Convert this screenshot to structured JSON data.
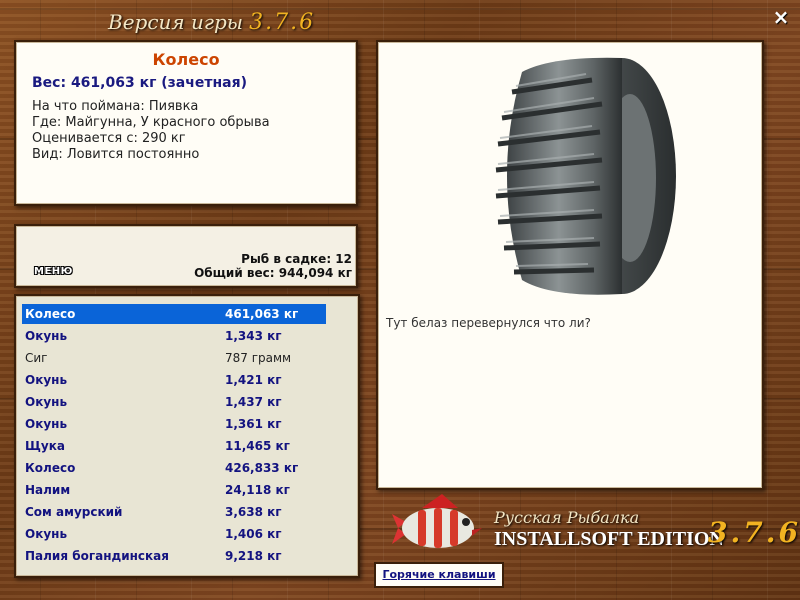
{
  "header": {
    "title": "Версия игры",
    "version": "3.7.6"
  },
  "close_icon": "×",
  "info": {
    "name": "Колесо",
    "weight_line": "Вес: 461,063 кг (зачетная)",
    "bait": "На что поймана: Пиявка",
    "place": "Где: Майгунна, У красного обрыва",
    "rated_from": "Оценивается с: 290 кг",
    "kind": "Вид: Ловится постоянно"
  },
  "stats": {
    "menu_label": "МЕНЮ",
    "fish_in_keepnet": "Рыб в садке: 12",
    "total_weight": "Общий вес: 944,094 кг"
  },
  "catch": [
    {
      "name": "Колесо",
      "weight": "461,063 кг",
      "selected": true
    },
    {
      "name": "Окунь",
      "weight": "1,343 кг"
    },
    {
      "name": "Сиг",
      "weight": "787 грамм",
      "plain": true
    },
    {
      "name": "Окунь",
      "weight": "1,421 кг"
    },
    {
      "name": "Окунь",
      "weight": "1,437 кг"
    },
    {
      "name": "Окунь",
      "weight": "1,361 кг"
    },
    {
      "name": "Щука",
      "weight": "11,465 кг"
    },
    {
      "name": "Колесо",
      "weight": "426,833 кг"
    },
    {
      "name": "Налим",
      "weight": "24,118 кг"
    },
    {
      "name": "Сом амурский",
      "weight": "3,638 кг"
    },
    {
      "name": "Окунь",
      "weight": "1,406 кг"
    },
    {
      "name": "Палия богандинская",
      "weight": "9,218 кг"
    }
  ],
  "view": {
    "image_icon": "tire-icon",
    "description": "Тут белаз перевернулся что ли?"
  },
  "logo": {
    "line1": "Русская Рыбалка",
    "line2": "INSTALLSOFT EDITION",
    "version": "3.7.6",
    "fish_icon": "fish-icon"
  },
  "hotkeys_label": "Горячие клавиши",
  "colors": {
    "accent_orange": "#cc4400",
    "text_blue": "#131380",
    "selection": "#0a64d8",
    "version_gold": "#f2b321"
  }
}
